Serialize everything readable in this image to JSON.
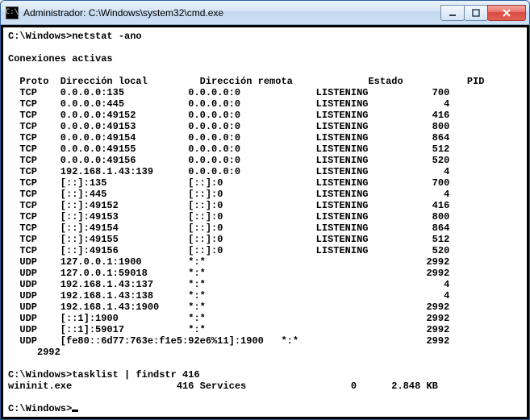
{
  "window": {
    "title": "Administrador: C:\\Windows\\system32\\cmd.exe"
  },
  "prompt1": "C:\\Windows>",
  "cmd1": "netstat -ano",
  "heading": "Conexiones activas",
  "cols": {
    "proto": "Proto",
    "local": "Dirección local",
    "remote": "Dirección remota",
    "state": "Estado",
    "pid": "PID"
  },
  "rows": [
    {
      "proto": "TCP",
      "local": "0.0.0.0:135",
      "remote": "0.0.0.0:0",
      "state": "LISTENING",
      "pid": "700"
    },
    {
      "proto": "TCP",
      "local": "0.0.0.0:445",
      "remote": "0.0.0.0:0",
      "state": "LISTENING",
      "pid": "4"
    },
    {
      "proto": "TCP",
      "local": "0.0.0.0:49152",
      "remote": "0.0.0.0:0",
      "state": "LISTENING",
      "pid": "416"
    },
    {
      "proto": "TCP",
      "local": "0.0.0.0:49153",
      "remote": "0.0.0.0:0",
      "state": "LISTENING",
      "pid": "800"
    },
    {
      "proto": "TCP",
      "local": "0.0.0.0:49154",
      "remote": "0.0.0.0:0",
      "state": "LISTENING",
      "pid": "864"
    },
    {
      "proto": "TCP",
      "local": "0.0.0.0:49155",
      "remote": "0.0.0.0:0",
      "state": "LISTENING",
      "pid": "512"
    },
    {
      "proto": "TCP",
      "local": "0.0.0.0:49156",
      "remote": "0.0.0.0:0",
      "state": "LISTENING",
      "pid": "520"
    },
    {
      "proto": "TCP",
      "local": "192.168.1.43:139",
      "remote": "0.0.0.0:0",
      "state": "LISTENING",
      "pid": "4"
    },
    {
      "proto": "TCP",
      "local": "[::]:135",
      "remote": "[::]:0",
      "state": "LISTENING",
      "pid": "700"
    },
    {
      "proto": "TCP",
      "local": "[::]:445",
      "remote": "[::]:0",
      "state": "LISTENING",
      "pid": "4"
    },
    {
      "proto": "TCP",
      "local": "[::]:49152",
      "remote": "[::]:0",
      "state": "LISTENING",
      "pid": "416"
    },
    {
      "proto": "TCP",
      "local": "[::]:49153",
      "remote": "[::]:0",
      "state": "LISTENING",
      "pid": "800"
    },
    {
      "proto": "TCP",
      "local": "[::]:49154",
      "remote": "[::]:0",
      "state": "LISTENING",
      "pid": "864"
    },
    {
      "proto": "TCP",
      "local": "[::]:49155",
      "remote": "[::]:0",
      "state": "LISTENING",
      "pid": "512"
    },
    {
      "proto": "TCP",
      "local": "[::]:49156",
      "remote": "[::]:0",
      "state": "LISTENING",
      "pid": "520"
    },
    {
      "proto": "UDP",
      "local": "127.0.0.1:1900",
      "remote": "*:*",
      "state": "",
      "pid": "2992"
    },
    {
      "proto": "UDP",
      "local": "127.0.0.1:59018",
      "remote": "*:*",
      "state": "",
      "pid": "2992"
    },
    {
      "proto": "UDP",
      "local": "192.168.1.43:137",
      "remote": "*:*",
      "state": "",
      "pid": "4"
    },
    {
      "proto": "UDP",
      "local": "192.168.1.43:138",
      "remote": "*:*",
      "state": "",
      "pid": "4"
    },
    {
      "proto": "UDP",
      "local": "192.168.1.43:1900",
      "remote": "*:*",
      "state": "",
      "pid": "2992"
    },
    {
      "proto": "UDP",
      "local": "[::1]:1900",
      "remote": "*:*",
      "state": "",
      "pid": "2992"
    },
    {
      "proto": "UDP",
      "local": "[::1]:59017",
      "remote": "*:*",
      "state": "",
      "pid": "2992"
    }
  ],
  "long_row": {
    "proto": "UDP",
    "local": "[fe80::6d77:763e:f1e5:92e6%11]:1900",
    "remote": "*:*",
    "state": "",
    "pid": "2992"
  },
  "prompt2": "C:\\Windows>",
  "cmd2": "tasklist | findstr 416",
  "task_result": {
    "name": "wininit.exe",
    "pid": "416",
    "session": "Services",
    "sessnum": "0",
    "mem": "2.848 KB"
  },
  "prompt3": "C:\\Windows>"
}
